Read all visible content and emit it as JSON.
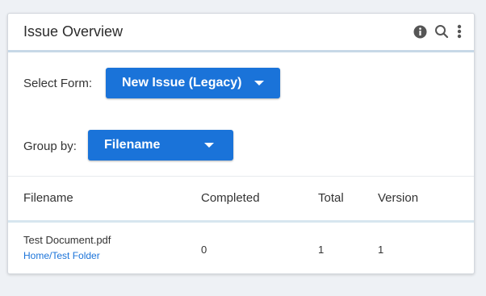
{
  "header": {
    "title": "Issue Overview",
    "icons": [
      "info-icon",
      "search-icon",
      "more-vertical-icon"
    ]
  },
  "form_select": {
    "label": "Select Form:",
    "value": "New Issue (Legacy)"
  },
  "group_by": {
    "label": "Group by:",
    "value": "Filename"
  },
  "table": {
    "columns": [
      "Filename",
      "Completed",
      "Total",
      "Version"
    ],
    "rows": [
      {
        "filename": "Test Document.pdf",
        "path": [
          "Home",
          "Test Folder"
        ],
        "completed": "0",
        "total": "1",
        "version": "1"
      }
    ]
  },
  "colors": {
    "accent": "#1a73d9",
    "header_border": "#c7d8e7"
  }
}
